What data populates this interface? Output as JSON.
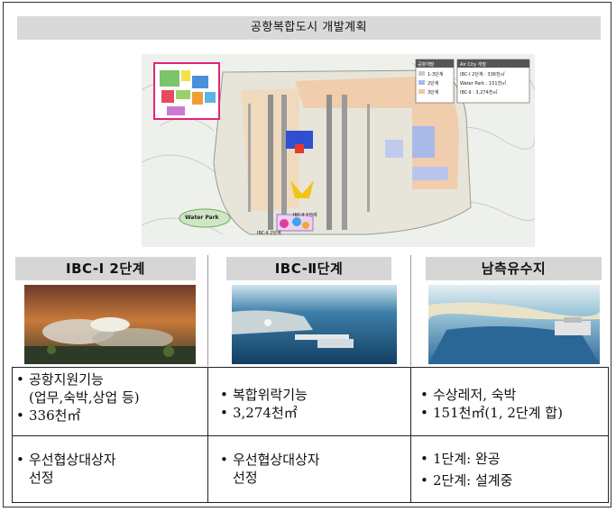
{
  "title": "공항복합도시 개발계획",
  "map": {
    "legend_left": [
      "1-3단계",
      "2단계",
      "3단계"
    ],
    "legend_left_header": "공항개발",
    "legend_right_header": "Air City 개발",
    "legend_right": [
      "IBC-Ⅰ 2단계 : 336천㎡",
      "Water Park : 151천㎡",
      "IBC-Ⅱ : 3,274천㎡"
    ],
    "labels": [
      "Water Park",
      "IBC-Ⅱ 2단계",
      "IBC-Ⅱ 1단계"
    ]
  },
  "columns": [
    {
      "heading": "IBC-Ⅰ 2단계",
      "function_lines": [
        "공항지원기능",
        "(업무,숙박,상업 등)",
        "336천㎡"
      ],
      "status_lines": [
        "우선협상대상자",
        "선정"
      ]
    },
    {
      "heading": "IBC-Ⅱ단계",
      "function_lines": [
        "복합위락기능",
        "3,274천㎡"
      ],
      "status_lines": [
        "우선협상대상자",
        "선정"
      ]
    },
    {
      "heading": "남측유수지",
      "function_lines": [
        "수상레저, 숙박",
        "151천㎡(1, 2단계 합)"
      ],
      "status_lines": [
        "1단계: 완공",
        "2단계: 설계중"
      ]
    }
  ]
}
